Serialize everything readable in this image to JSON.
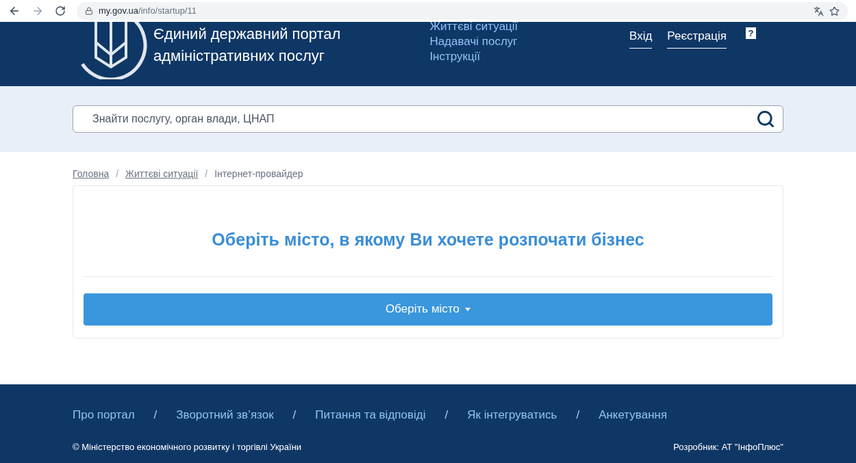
{
  "browser": {
    "url_host": "my.gov.ua",
    "url_path": "/info/startup/11"
  },
  "header": {
    "logo_line_1": "Єдиний державний портал",
    "logo_line_2": "адміністративних послуг",
    "nav": [
      "Життєві ситуації",
      "Надавачі послуг",
      "Інструкції"
    ],
    "auth": [
      "Вхід",
      "Реєстрація"
    ],
    "help": "?"
  },
  "search": {
    "placeholder": "Знайти послугу, орган влади, ЦНАП"
  },
  "breadcrumbs": [
    {
      "label": "Головна",
      "kind": "link"
    },
    {
      "label": "/",
      "kind": "separator"
    },
    {
      "label": "Життєві ситуації",
      "kind": "link"
    },
    {
      "label": "/",
      "kind": "separator"
    },
    {
      "label": "Інтернет-провайдер",
      "kind": "current"
    }
  ],
  "card": {
    "title": "Оберіть місто, в якому Ви хочете розпочати бізнес",
    "button": "Оберіть місто"
  },
  "footer": {
    "links": [
      {
        "label": "Про портал",
        "kind": "link"
      },
      {
        "label": "/",
        "kind": "separator"
      },
      {
        "label": "Зворотний зв’язок",
        "kind": "link"
      },
      {
        "label": "/",
        "kind": "separator"
      },
      {
        "label": "Питання та відповіді",
        "kind": "link"
      },
      {
        "label": "/",
        "kind": "separator"
      },
      {
        "label": "Як інтегруватись",
        "kind": "link"
      },
      {
        "label": "/",
        "kind": "separator"
      },
      {
        "label": "Анкетування",
        "kind": "link"
      }
    ],
    "copyright": "© Міністерство економічного розвитку і торгівлі України",
    "developer": "Розробник: АТ \"ІнфоПлюс\""
  }
}
